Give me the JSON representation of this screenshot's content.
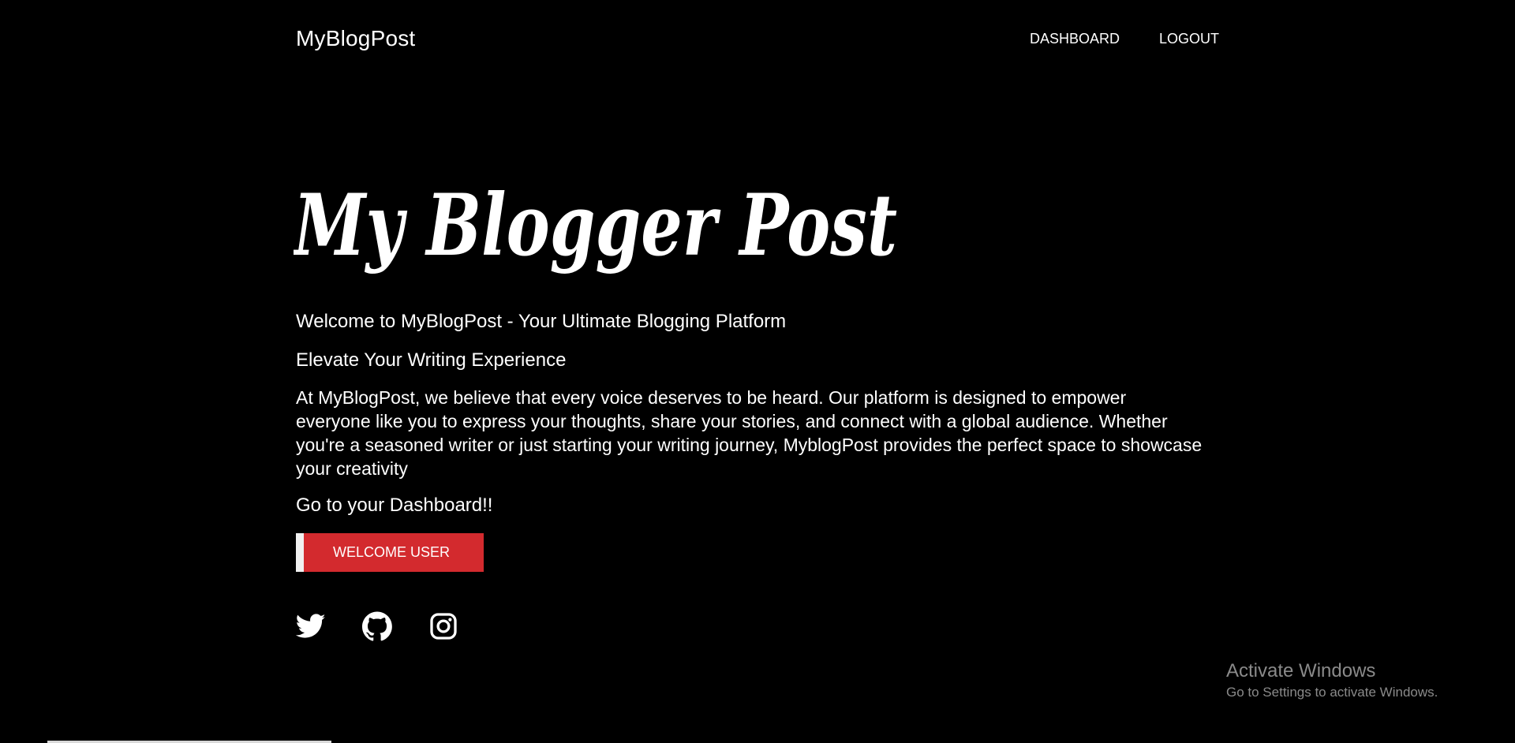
{
  "header": {
    "brand": "MyBlogPost",
    "nav": [
      {
        "label": "DASHBOARD"
      },
      {
        "label": "LOGOUT"
      }
    ]
  },
  "hero": {
    "title": "My Blogger Post",
    "headline": "Welcome to MyBlogPost - Your Ultimate Blogging Platform",
    "subhead": "Elevate Your Writing Experience",
    "paragraph": "At MyBlogPost, we believe that every voice deserves to be heard. Our platform is designed to empower everyone like you to express your thoughts, share your stories, and connect with a global audience. Whether you're a seasoned writer or just starting your writing journey, MyblogPost provides the perfect space to showcase your creativity",
    "cta_text": "Go to your Dashboard!!",
    "button_label": "WELCOME USER"
  },
  "social": [
    {
      "icon": "twitter-icon"
    },
    {
      "icon": "github-icon"
    },
    {
      "icon": "instagram-icon"
    }
  ],
  "watermark": {
    "line1": "Activate Windows",
    "line2": "Go to Settings to activate Windows."
  },
  "colors": {
    "background": "#000000",
    "text": "#ffffff",
    "button": "#d32a2e",
    "watermark": "#8a8a8a"
  }
}
